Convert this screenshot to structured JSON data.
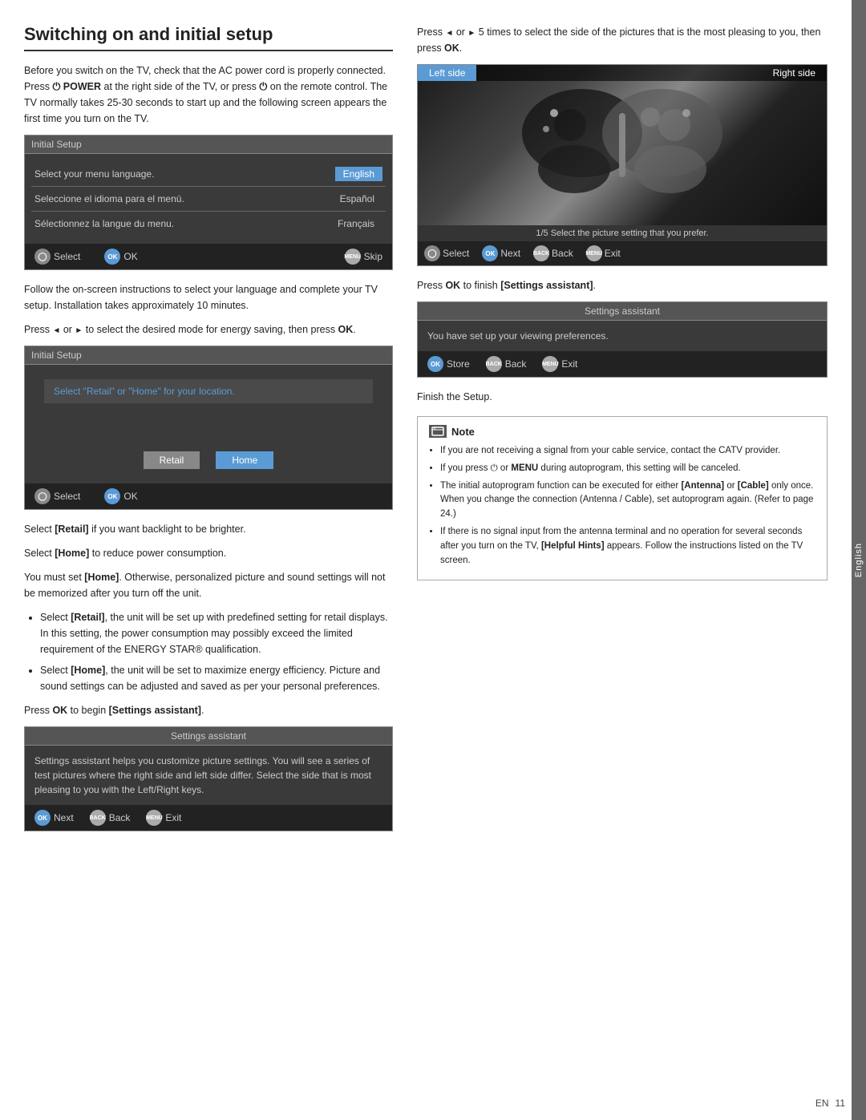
{
  "page": {
    "title": "Switching on and initial setup",
    "sidebar_label": "English",
    "page_number": "11",
    "en_label": "EN"
  },
  "intro": {
    "text": "Before you switch on the TV, check that the AC power cord is properly connected. Press",
    "bold1": "POWER",
    "mid": "at the right side of the TV, or press",
    "end": "on the remote control. The TV normally takes 25-30 seconds to start up and the following screen appears the first time you turn on the TV."
  },
  "initial_setup_1": {
    "title": "Initial Setup",
    "rows": [
      {
        "label": "Select your menu language.",
        "btn": "English",
        "selected": true
      },
      {
        "label": "Seleccione el idioma para el menú.",
        "btn": "Español",
        "selected": false
      },
      {
        "label": "Sélectionnez la langue du menu.",
        "btn": "Français",
        "selected": false
      }
    ],
    "footer": {
      "select_label": "Select",
      "ok_label": "OK",
      "skip_label": "Skip"
    }
  },
  "follow_text": "Follow the on-screen instructions to select your language and complete your TV setup. Installation takes approximately 10 minutes.",
  "press_energy": "Press ◄ or ► to select the desired mode for energy saving, then press OK.",
  "initial_setup_2": {
    "title": "Initial Setup",
    "row_label": "Select \"Retail\" or \"Home\" for your location.",
    "btn_retail": "Retail",
    "btn_home": "Home",
    "footer": {
      "select_label": "Select",
      "ok_label": "OK"
    }
  },
  "select_retail": "Select [Retail] if you want backlight to be brighter.",
  "select_home": "Select [Home] to reduce power consumption.",
  "must_set_home": "You must set [Home]. Otherwise, personalized picture and sound settings will not be memorized after you turn off the unit.",
  "bullets": [
    "Select [Retail], the unit will be set up with predefined setting for retail displays. In this setting, the power consumption may possibly exceed the limited requirement of the ENERGY STAR® qualification.",
    "Select [Home], the unit will be set to maximize energy efficiency. Picture and sound settings can be adjusted and saved as per your personal preferences."
  ],
  "press_begin": "Press OK to begin [Settings assistant].",
  "settings_assistant_1": {
    "title": "Settings assistant",
    "body": "Settings assistant helps you customize picture settings. You will see a series of test pictures where the right side and left side differ. Select the side that is most pleasing to you with the Left/Right keys.",
    "footer": {
      "next_label": "Next",
      "back_label": "Back",
      "exit_label": "Exit"
    }
  },
  "right_col": {
    "press_select": "Press ◄ or ► 5 times to select the side of the pictures that is the most pleasing to you, then press OK.",
    "picture_box": {
      "left_side": "Left side",
      "right_side": "Right side",
      "caption": "1/5 Select the picture setting that you prefer.",
      "nav": {
        "select_label": "Select",
        "next_label": "Next",
        "back_label": "Back",
        "exit_label": "Exit"
      }
    },
    "press_finish": "Press OK to finish [Settings assistant].",
    "settings_assistant_2": {
      "title": "Settings assistant",
      "body": "You have set up your viewing preferences.",
      "footer": {
        "store_label": "Store",
        "back_label": "Back",
        "exit_label": "Exit"
      }
    },
    "finish_setup": "Finish the Setup.",
    "note": {
      "header": "Note",
      "items": [
        "If you are not receiving a signal from your cable service, contact the CATV provider.",
        "If you press ⏻ or MENU during autoprogram, this setting will be canceled.",
        "The initial autoprogram function can be executed for either [Antenna] or [Cable] only once. When you change the connection (Antenna / Cable), set autoprogram again. (Refer to page 24.)",
        "If there is no signal input from the antenna terminal and no operation for several seconds after you turn on the TV, [Helpful Hints] appears. Follow the instructions listed on the TV screen."
      ]
    }
  }
}
